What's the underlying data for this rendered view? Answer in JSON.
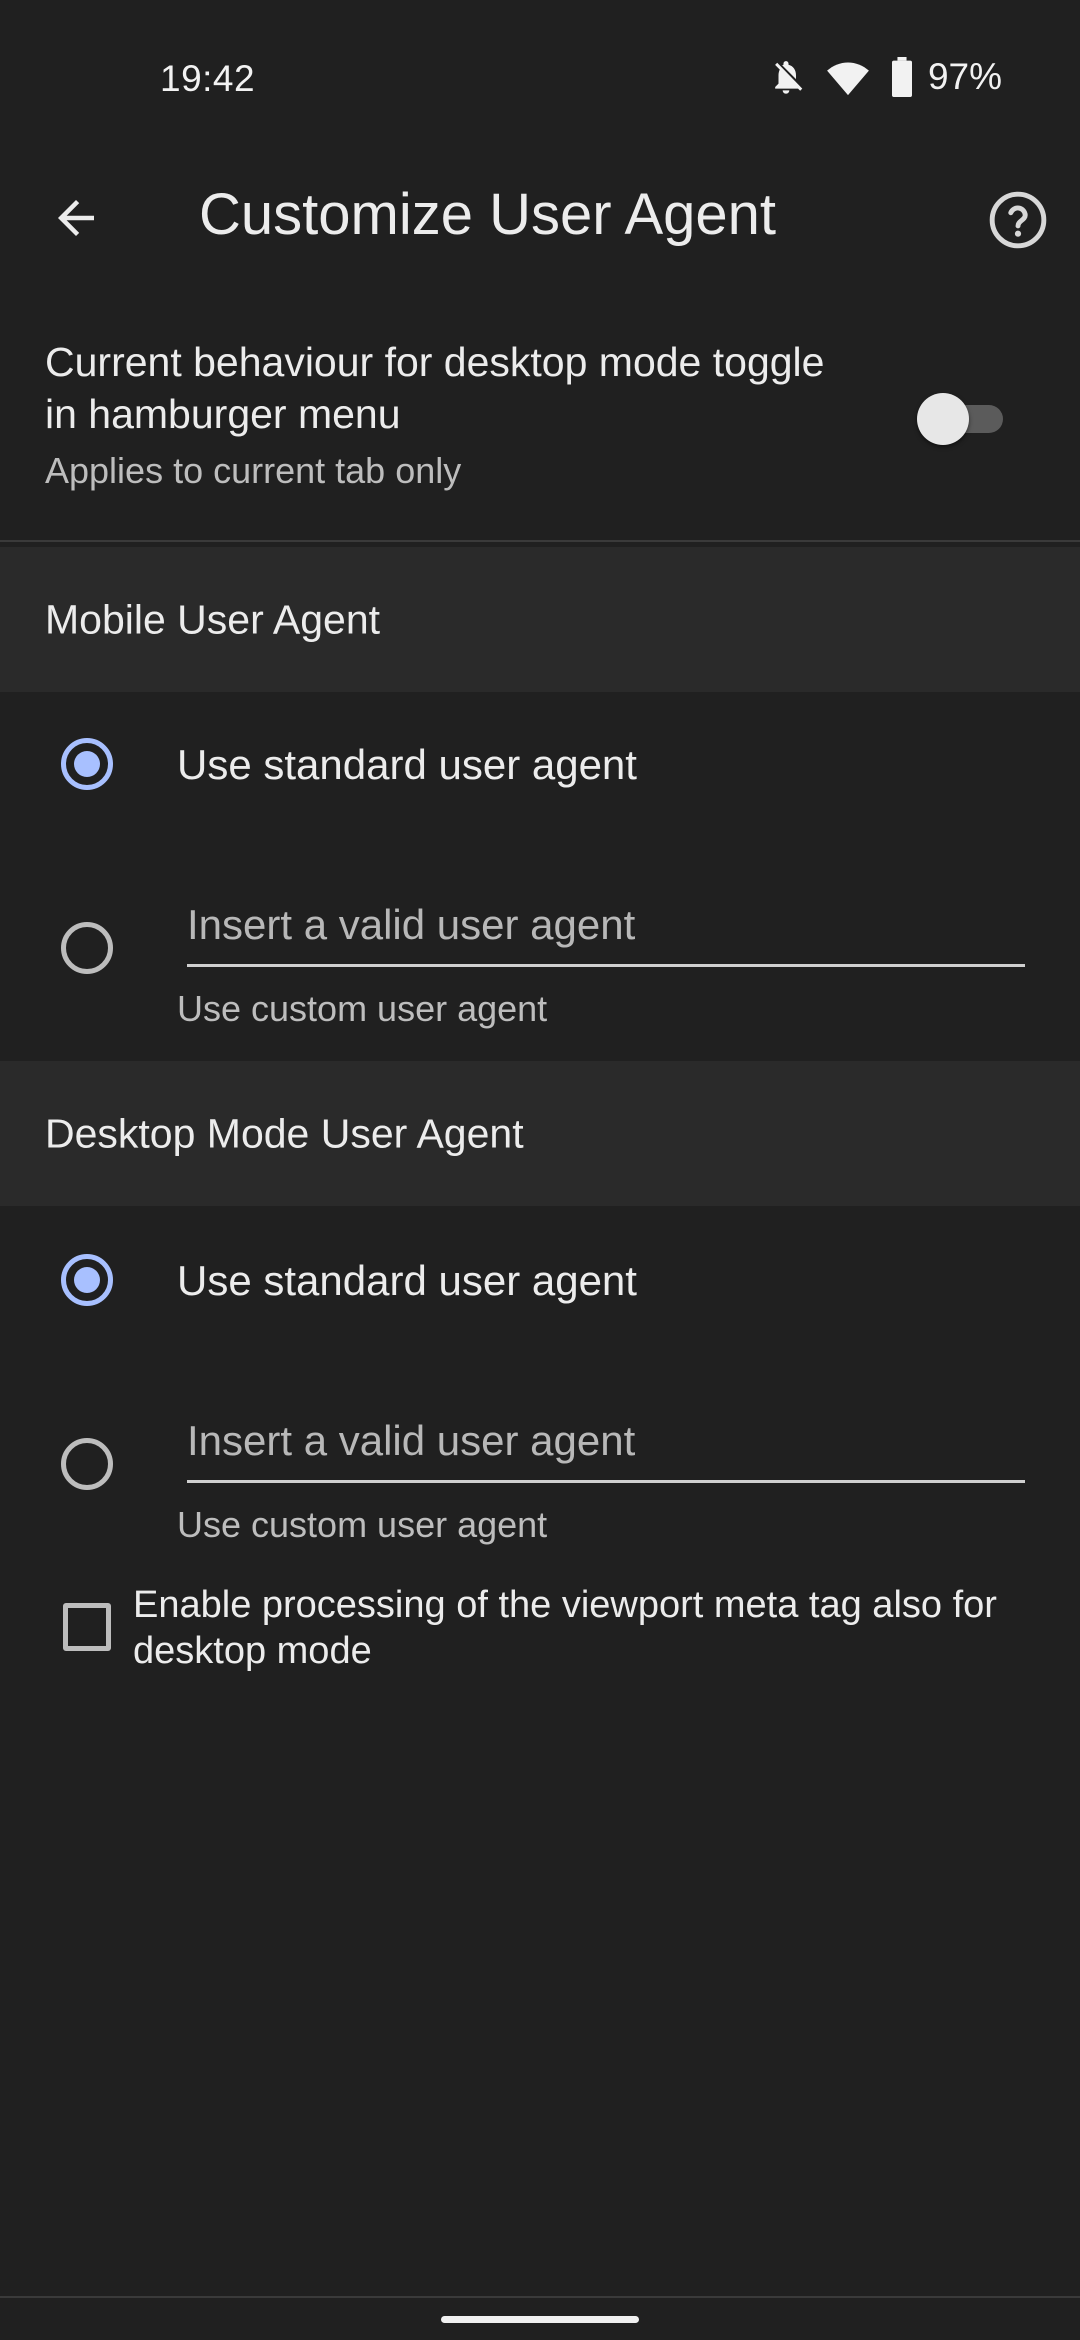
{
  "status_bar": {
    "time": "19:42",
    "battery_percent": "97%",
    "icons": [
      "notifications-off-icon",
      "wifi-icon",
      "battery-icon"
    ]
  },
  "app_bar": {
    "title": "Customize User Agent",
    "back_icon": "arrow-back-icon",
    "help_icon": "help-circle-icon"
  },
  "desktop_toggle": {
    "title": "Current behaviour for desktop mode toggle in hamburger menu",
    "subtitle": "Applies to current tab only",
    "enabled": false
  },
  "mobile_section": {
    "header": "Mobile User Agent",
    "standard_option": {
      "label": "Use standard user agent",
      "selected": true
    },
    "custom_option": {
      "selected": false,
      "input_value": "",
      "placeholder": "Insert a valid user agent",
      "helper": "Use custom user agent"
    }
  },
  "desktop_section": {
    "header": "Desktop Mode User Agent",
    "standard_option": {
      "label": "Use standard user agent",
      "selected": true
    },
    "custom_option": {
      "selected": false,
      "input_value": "",
      "placeholder": "Insert a valid user agent",
      "helper": "Use custom user agent"
    }
  },
  "viewport_checkbox": {
    "label": "Enable processing of the viewport meta tag also for desktop mode",
    "checked": false
  },
  "colors": {
    "background": "#202020",
    "section_header": "#2a2a2a",
    "accent": "#a8c0ff",
    "text_primary": "#ececec",
    "text_secondary": "#bdbdbd"
  }
}
